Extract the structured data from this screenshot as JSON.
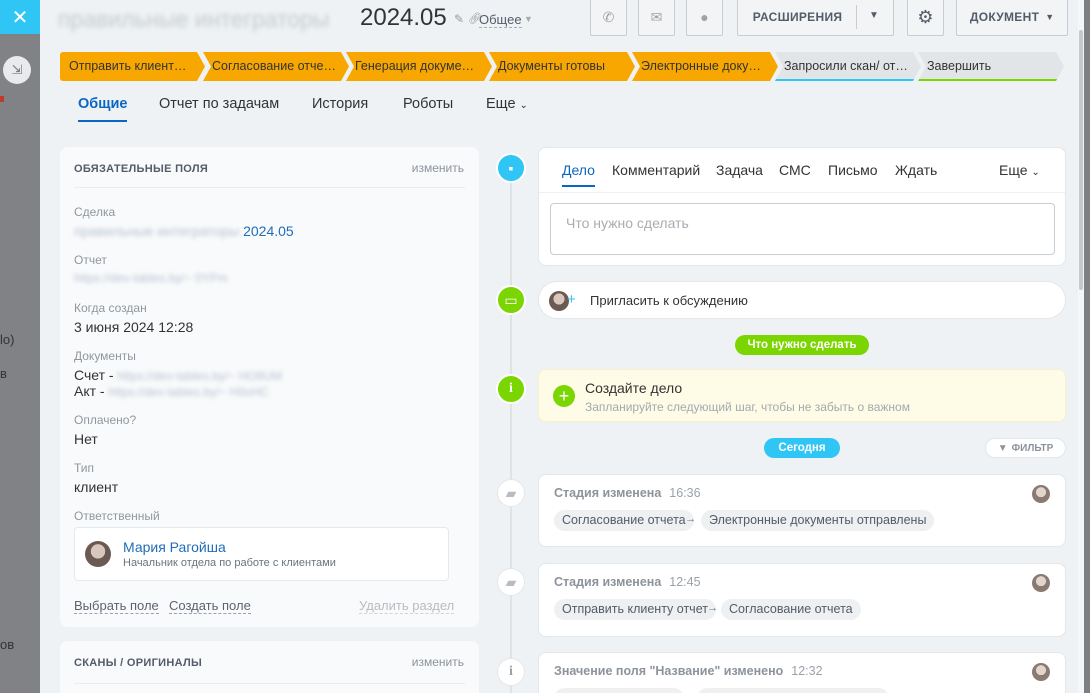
{
  "left": {
    "close_icon": "close-icon",
    "texts": [
      "lo)",
      "в",
      "ов"
    ]
  },
  "header": {
    "title_blurred": "правильные интеграторы",
    "title_number": "2024.05",
    "category": "Общее",
    "extensions_label": "РАСШИРЕНИЯ",
    "document_label": "ДОКУМЕНТ"
  },
  "stages": [
    {
      "label": "Отправить клиент…",
      "color": "#f7a700"
    },
    {
      "label": "Согласование отче…",
      "color": "#f7a700"
    },
    {
      "label": "Генерация докуме…",
      "color": "#f7a700"
    },
    {
      "label": "Документы готовы",
      "color": "#f7a700"
    },
    {
      "label": "Электронные доку…",
      "color": "#f7a700"
    },
    {
      "label": "Запросили скан/ от…",
      "color": "#e2e5e8",
      "line": "#2fc6f6"
    },
    {
      "label": "Завершить",
      "color": "#e2e5e8",
      "line": "#7bd500"
    }
  ],
  "tabs": [
    "Общие",
    "Отчет по задачам",
    "История",
    "Роботы",
    "Еще"
  ],
  "required": {
    "heading": "ОБЯЗАТЕЛЬНЫЕ ПОЛЯ",
    "edit": "изменить",
    "deal_label": "Сделка",
    "deal_value_blurred": "правильные интеграторы",
    "deal_value": "2024.05",
    "report_label": "Отчет",
    "report_value_blurred": "https://dev-tables.by/~ 0YPm",
    "created_label": "Когда создан",
    "created_value": "3 июня 2024 12:28",
    "documents_label": "Документы",
    "doc1_prefix": "Счет -",
    "doc1_blurred": "https://dev-tables.by/~ HO8UM",
    "doc2_prefix": "Акт -",
    "doc2_blurred": "https://dev-tables.by/~ H0oHC",
    "paid_label": "Оплачено?",
    "paid_value": "Нет",
    "type_label": "Тип",
    "type_value": "клиент",
    "responsible_label": "Ответственный",
    "responsible_name": "Мария Рагойша",
    "responsible_role": "Начальник отдела по работе с клиентами",
    "select_field": "Выбрать поле",
    "create_field": "Создать поле",
    "delete_section": "Удалить раздел"
  },
  "scans": {
    "heading": "СКАНЫ / ОРИГИНАЛЫ",
    "edit": "изменить"
  },
  "editor": {
    "tabs": [
      "Дело",
      "Комментарий",
      "Задача",
      "СМС",
      "Письмо",
      "Ждать"
    ],
    "more": "Еще",
    "placeholder": "Что нужно сделать"
  },
  "invite": "Пригласить к обсуждению",
  "todo_pill": "Что нужно сделать",
  "create_deal": {
    "title": "Создайте дело",
    "subtitle": "Запланируйте следующий шаг, чтобы не забыть о важном"
  },
  "today_pill": "Сегодня",
  "filter": "ФИЛЬТР",
  "events": [
    {
      "title": "Стадия изменена",
      "time": "16:36",
      "from": "Согласование отчета",
      "to": "Электронные документы отправлены"
    },
    {
      "title": "Стадия изменена",
      "time": "12:45",
      "from": "Отправить клиенту отчет",
      "to": "Согласование отчета"
    },
    {
      "title": "Значение поля \"Название\" изменено",
      "time": "12:32"
    }
  ],
  "colors": {
    "accent": "#2fc6f6",
    "stage": "#f7a700",
    "link": "#0b66c3",
    "green": "#7bd500"
  }
}
